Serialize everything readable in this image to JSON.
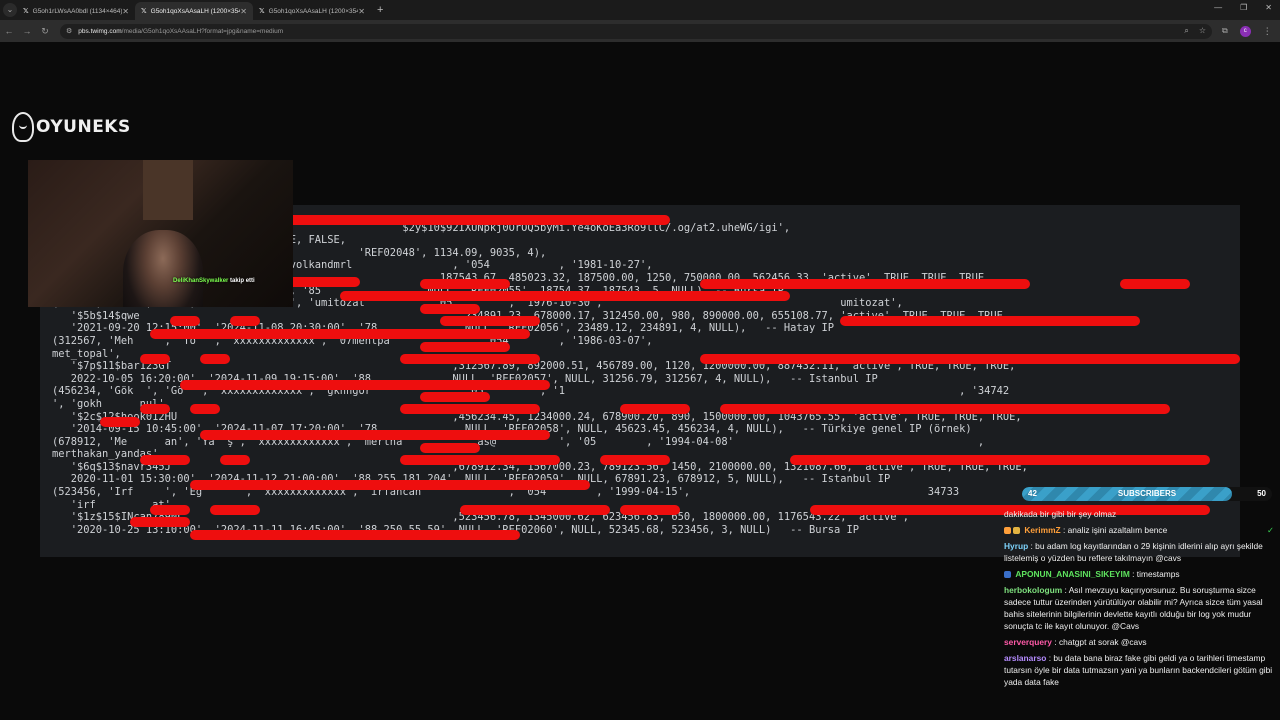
{
  "browser": {
    "tabs": [
      {
        "label": "G5oh1rLWsAA0bdl (1134×464)"
      },
      {
        "label": "G5oh1qoXsAAsaLH (1200×354)"
      },
      {
        "label": "G5oh1qoXsAAsaLH (1200×354)"
      }
    ],
    "url_domain": "pbs.twimg.com",
    "url_path": "/media/G5oh1qoXsAAsaLH?format=jpg&name=medium",
    "profile_initial": "c"
  },
  "stream": {
    "logo": "OYUNEKS",
    "webcam_follow_user": "DeliKhanSkywalker",
    "webcam_follow_text": "takip etti"
  },
  "terminal": {
    "lines": [
      "                          ",
      "                                                        $2y$10$92IXUNpkj0OrOQ5byMi.Ye4oKoEa3Ro9llC/.og/at2.uheWG/igi',",
      "                            FALSE, TRUE, FALSE,",
      "                                                 'REF02048', 1134.09, 9035, 4),",
      "                           xxxxxxx', 'volkandmrl                , '054           , '1981-10-27',",
      "                                                             ,187543.67, 485023.32, 187500.00, 1250, 750000.00, 562456.33, 'active', TRUE, TRUE, TRUE,",
      "                          10 18:45:00', '85               , NULL, 'REF02055', 18754.37, 187543, 5, NULL), -- Bursa IP",
      "(234891, 'Üm  ', 'Öz ', 'xxxxxxxxxxxxx', 'umitozat        ', '05         , '1976-10-30',                                      umitozat',",
      "   '$5b$14$qwe                                                  , 234891.23, 678000.17, 312450.00, 980, 890000.00, 655108.77, 'active', TRUE, TRUE, TRUE,",
      "   '2021-09-20 12:15:00', '2024-11-08 20:30:00', '78.           , NULL, 'REF02056', 23489.12, 234891, 4, NULL),   -- Hatay IP",
      "(312567, 'Meh    ', 'To  ', 'xxxxxxxxxxxxx', '07mehtpa            ', '054        , '1986-03-07',",
      "met_topal',",
      "   '$7p$11$bar123GT                                             ,312567.89, 892000.51, 456789.00, 1120, 1200000.00, 887432.11, 'active', TRUE, TRUE, TRUE,",
      "   2022-10-05 16:20:00', '2024-11-09 19:15:00', '88.          , NULL, 'REF02057', NULL, 31256.79, 312567, 4, NULL),   -- Istanbul IP",
      "(456234, 'Gök  ', 'Gö  ', 'xxxxxxxxxxxxx', 'gkhngor            ', '05         , '1                                                               , '34742",
      "', 'gokh      nul',",
      "   '$2c$12$hook012HU                                            ,456234.45, 1234000.24, 678900.20, 890, 1500000.00, 1043765.55, 'active', TRUE, TRUE, TRUE,",
      "   '2014-09-15 10:45:00', '2024-11-07 17:20:00', '78.           , NULL, 'REF02058', NULL, 45623.45, 456234, 4, NULL),   -- Türkiye genel IP (örnek)",
      "(678912, 'Me      an', 'Ya  ş', 'xxxxxxxxxxxxx', 'mertha            as@          ', '05        , '1994-04-08'                                       ,",
      "merthakan_yandas',",
      "   '$6q$13$navr345J                                             ,678912.34, 1567000.23, 789123.56, 1450, 2100000.00, 1321087.66, 'active', TRUE, TRUE, TRUE,",
      "   2020-11-01 15:30:00', '2024-11-12 21:00:00', '88.255.181.204', NULL, 'REF02059', NULL, 67891.23, 678912, 5, NULL),   -- Istanbul IP",
      "(523456, 'Irf     ', 'Eğ      ', 'xxxxxxxxxxxxx', 'irfancan             ', '054        , '1999-04-15',                                      34733",
      "   'irf         at',",
      "   '$1z$15$INcan789NL                                           ,523456.78, 1345000.62, 623456.83, 650, 1800000.00, 1176543.22, 'active',",
      "   '2020-10-25 13:10:00', '2024-11-11 16:45:00', '88.250.55.59', NULL, 'REF02060', NULL, 52345.68, 523456, 3, NULL)   -- Bursa IP"
    ]
  },
  "subscribers": {
    "current": "42",
    "label": "SUBSCRIBERS",
    "goal": "50",
    "fill_fraction": 0.84
  },
  "chat": {
    "partial_top": "dakikada bir gibi bir şey olmaz",
    "messages": [
      {
        "user": "KerimmZ",
        "text": " : analiz işini azaltalım bence",
        "color": "#ff9f3a"
      },
      {
        "user": "Hyrup",
        "text": " : bu adam log kayıtlarından o 29 kişinin idlerini alıp ayrı şekilde listelemiş o yüzden bu reflere takılmayın @cavs",
        "color": "#7dd3fc"
      },
      {
        "user": "APONUN_ANASINI_SIKEYIM",
        "text": " : timestamps",
        "color": "#5ee35e"
      },
      {
        "user": "herbokologum",
        "text": " : Asıl mevzuyu kaçırıyorsunuz. Bu soruşturma sizce sadece tuttur üzerinden yürütülüyor olabilir mi? Ayrıca sizce tüm yasal bahis sitelerinin bilgilerinin devlette kayıtlı olduğu bir log yok mudur sonuçta tc ile kayıt olunuyor. @Cavs",
        "color": "#7ee07e"
      },
      {
        "user": "serverquery",
        "text": " : chatgpt at sorak @cavs",
        "color": "#ff5aa8"
      },
      {
        "user": "arslanarso",
        "text": " : bu data bana biraz fake gibi geldi ya o tarihleri timestamp tutarsın öyle bir data tutmazsın yani ya bunların backendcileri götüm gibi yada data fake",
        "color": "#b58cff"
      }
    ]
  }
}
